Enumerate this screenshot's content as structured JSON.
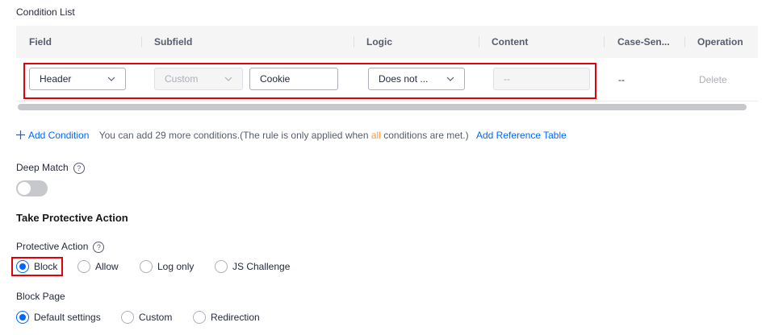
{
  "conditions": {
    "title": "Condition List",
    "columns": [
      "Field",
      "Subfield",
      "Logic",
      "Content",
      "Case-Sen...",
      "Operation"
    ],
    "row": {
      "field": "Header",
      "subfield": "Custom",
      "subfield_value": "Cookie",
      "logic": "Does not ...",
      "content": "--",
      "case_sensitive": "--",
      "delete": "Delete"
    }
  },
  "add_condition": {
    "label": "Add Condition",
    "hint_before": "You can add 29 more conditions.(The rule is only applied when",
    "hint_highlight": "all",
    "hint_after": "conditions are met.)",
    "reference_link": "Add Reference Table"
  },
  "deep_match": {
    "label": "Deep Match",
    "enabled": false
  },
  "protective": {
    "heading": "Take Protective Action",
    "action_label": "Protective Action",
    "actions": [
      "Block",
      "Allow",
      "Log only",
      "JS Challenge"
    ],
    "selected_action": "Block",
    "block_page_label": "Block Page",
    "block_pages": [
      "Default settings",
      "Custom",
      "Redirection"
    ],
    "selected_block_page": "Default settings"
  },
  "colors": {
    "accent": "#0066ff",
    "highlight": "#e3000b",
    "emphasis": "#fa9841"
  }
}
